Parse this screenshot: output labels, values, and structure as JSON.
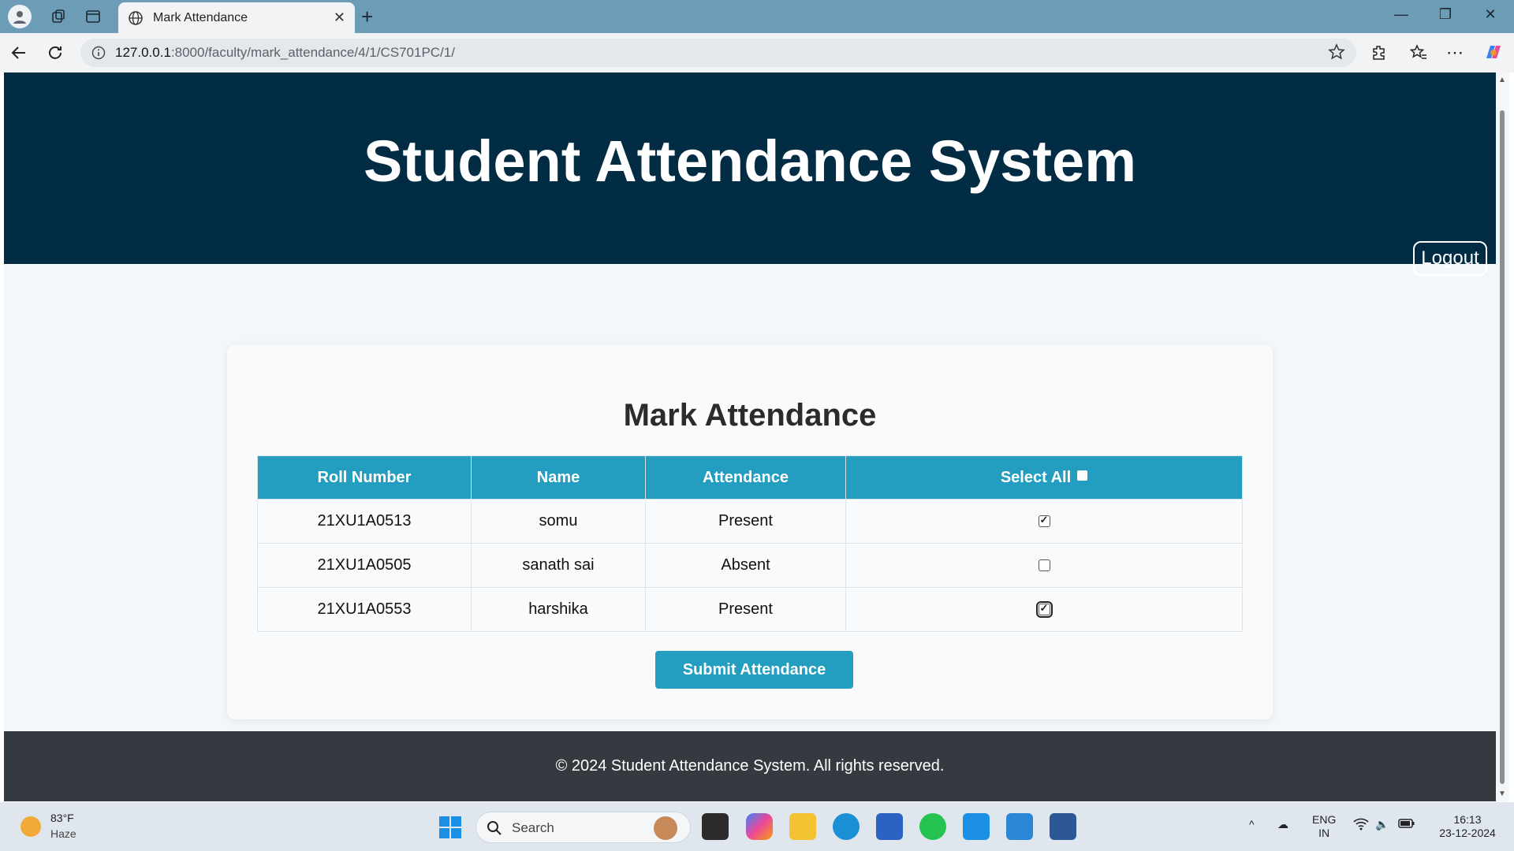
{
  "browser": {
    "tab_title": "Mark Attendance",
    "url_host": "127.0.0.1",
    "url_path": ":8000/faculty/mark_attendance/4/1/CS701PC/1/"
  },
  "page": {
    "site_title": "Student Attendance System",
    "logout_label": "Logout",
    "card_title": "Mark Attendance",
    "table": {
      "headers": [
        "Roll Number",
        "Name",
        "Attendance",
        "Select All"
      ],
      "rows": [
        {
          "roll": "21XU1A0513",
          "name": "somu",
          "attendance": "Present",
          "checked": true
        },
        {
          "roll": "21XU1A0505",
          "name": "sanath sai",
          "attendance": "Absent",
          "checked": false
        },
        {
          "roll": "21XU1A0553",
          "name": "harshika",
          "attendance": "Present",
          "checked": true
        }
      ]
    },
    "submit_label": "Submit Attendance",
    "footer": "© 2024 Student Attendance System. All rights reserved."
  },
  "taskbar": {
    "weather_temp": "83°F",
    "weather_desc": "Haze",
    "search_placeholder": "Search",
    "lang_top": "ENG",
    "lang_bottom": "IN",
    "time": "16:13",
    "date": "23-12-2024"
  },
  "colors": {
    "header_bg": "#012c44",
    "accent": "#239ec0",
    "footer_bg": "#343a40"
  }
}
